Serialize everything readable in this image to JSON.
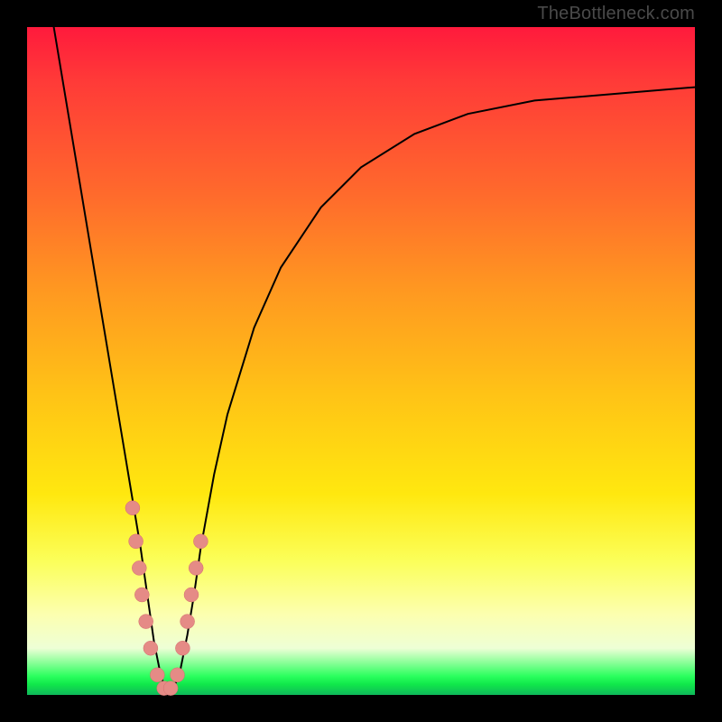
{
  "watermark": "TheBottleneck.com",
  "colors": {
    "frame": "#000000",
    "gradient_top": "#ff1a3c",
    "gradient_mid": "#ffe80f",
    "gradient_bottom_green": "#10e84a",
    "curve_stroke": "#000000",
    "bead_fill": "#e58b86",
    "bead_stroke": "#d46e6e"
  },
  "chart_data": {
    "type": "line",
    "title": "",
    "xlabel": "",
    "ylabel": "",
    "xlim": [
      0,
      100
    ],
    "ylim": [
      0,
      100
    ],
    "grid": false,
    "legend": false,
    "series": [
      {
        "name": "bottleneck-curve",
        "x": [
          4,
          6,
          8,
          10,
          12,
          14,
          16,
          17,
          18,
          19,
          20,
          21,
          22,
          23,
          24,
          25,
          26,
          28,
          30,
          34,
          38,
          44,
          50,
          58,
          66,
          76,
          88,
          100
        ],
        "y": [
          100,
          88,
          76,
          64,
          52,
          40,
          28,
          22,
          15,
          8,
          3,
          0,
          1,
          4,
          9,
          15,
          22,
          33,
          42,
          55,
          64,
          73,
          79,
          84,
          87,
          89,
          90,
          91
        ]
      }
    ],
    "markers": {
      "name": "beads",
      "note": "salmon circular markers clustered near the curve minimum on both branches",
      "points": [
        {
          "x": 15.8,
          "y": 28
        },
        {
          "x": 16.3,
          "y": 23
        },
        {
          "x": 16.8,
          "y": 19
        },
        {
          "x": 17.2,
          "y": 15
        },
        {
          "x": 17.8,
          "y": 11
        },
        {
          "x": 18.5,
          "y": 7
        },
        {
          "x": 19.5,
          "y": 3
        },
        {
          "x": 20.5,
          "y": 1
        },
        {
          "x": 21.5,
          "y": 1
        },
        {
          "x": 22.5,
          "y": 3
        },
        {
          "x": 23.3,
          "y": 7
        },
        {
          "x": 24.0,
          "y": 11
        },
        {
          "x": 24.6,
          "y": 15
        },
        {
          "x": 25.3,
          "y": 19
        },
        {
          "x": 26.0,
          "y": 23
        }
      ],
      "radius": 8
    },
    "annotations": [
      {
        "text": "TheBottleneck.com",
        "position": "top-right"
      }
    ]
  }
}
